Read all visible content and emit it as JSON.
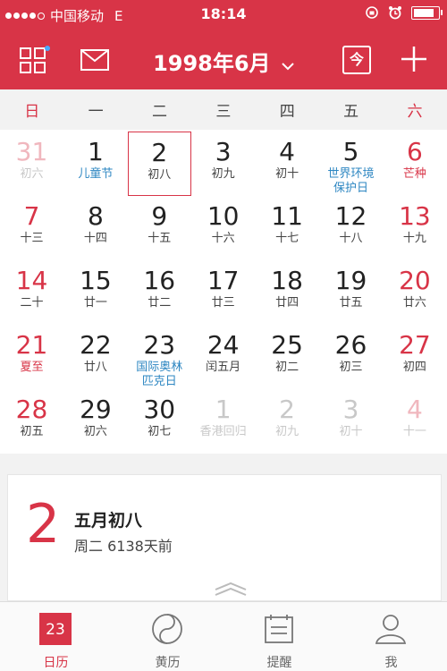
{
  "status_bar": {
    "carrier": "中国移动",
    "network": "E",
    "time": "18:14"
  },
  "toolbar": {
    "title": "1998年6月",
    "today_label": "今"
  },
  "weekdays": [
    "日",
    "一",
    "二",
    "三",
    "四",
    "五",
    "六"
  ],
  "days": [
    {
      "d": "31",
      "l": "初六",
      "t": "dim wkd"
    },
    {
      "d": "1",
      "l": "儿童节",
      "t": "fest"
    },
    {
      "d": "2",
      "l": "初八",
      "t": "sel"
    },
    {
      "d": "3",
      "l": "初九",
      "t": ""
    },
    {
      "d": "4",
      "l": "初十",
      "t": ""
    },
    {
      "d": "5",
      "l": "世界环境保护日",
      "t": "fest"
    },
    {
      "d": "6",
      "l": "芒种",
      "t": "wkd jieqi"
    },
    {
      "d": "7",
      "l": "十三",
      "t": "wkd"
    },
    {
      "d": "8",
      "l": "十四",
      "t": ""
    },
    {
      "d": "9",
      "l": "十五",
      "t": ""
    },
    {
      "d": "10",
      "l": "十六",
      "t": ""
    },
    {
      "d": "11",
      "l": "十七",
      "t": ""
    },
    {
      "d": "12",
      "l": "十八",
      "t": ""
    },
    {
      "d": "13",
      "l": "十九",
      "t": "wkd"
    },
    {
      "d": "14",
      "l": "二十",
      "t": "wkd"
    },
    {
      "d": "15",
      "l": "廿一",
      "t": ""
    },
    {
      "d": "16",
      "l": "廿二",
      "t": ""
    },
    {
      "d": "17",
      "l": "廿三",
      "t": ""
    },
    {
      "d": "18",
      "l": "廿四",
      "t": ""
    },
    {
      "d": "19",
      "l": "廿五",
      "t": ""
    },
    {
      "d": "20",
      "l": "廿六",
      "t": "wkd"
    },
    {
      "d": "21",
      "l": "夏至",
      "t": "wkd jieqi"
    },
    {
      "d": "22",
      "l": "廿八",
      "t": ""
    },
    {
      "d": "23",
      "l": "国际奥林匹克日",
      "t": "fest"
    },
    {
      "d": "24",
      "l": "闰五月",
      "t": ""
    },
    {
      "d": "25",
      "l": "初二",
      "t": ""
    },
    {
      "d": "26",
      "l": "初三",
      "t": ""
    },
    {
      "d": "27",
      "l": "初四",
      "t": "wkd"
    },
    {
      "d": "28",
      "l": "初五",
      "t": "wkd"
    },
    {
      "d": "29",
      "l": "初六",
      "t": ""
    },
    {
      "d": "30",
      "l": "初七",
      "t": ""
    },
    {
      "d": "1",
      "l": "香港回归",
      "t": "dim fest"
    },
    {
      "d": "2",
      "l": "初九",
      "t": "dim"
    },
    {
      "d": "3",
      "l": "初十",
      "t": "dim"
    },
    {
      "d": "4",
      "l": "十一",
      "t": "dim wkd"
    }
  ],
  "detail": {
    "day": "2",
    "lunar": "五月初八",
    "sub": "周二 6138天前"
  },
  "tabs": [
    {
      "label": "日历",
      "icon_text": "23",
      "active": true
    },
    {
      "label": "黄历",
      "active": false
    },
    {
      "label": "提醒",
      "active": false
    },
    {
      "label": "我",
      "active": false
    }
  ],
  "colors": {
    "accent": "#d83447",
    "festival": "#2e87c2"
  }
}
